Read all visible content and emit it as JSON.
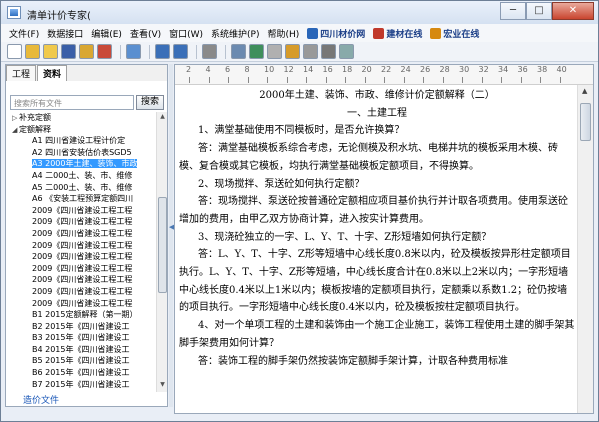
{
  "window": {
    "title": "清单计价专家("
  },
  "menu": [
    "文件(F)",
    "数据接口",
    "编辑(E)",
    "查看(V)",
    "窗口(W)",
    "系统维护(P)",
    "帮助(H)"
  ],
  "menu_extra": [
    {
      "label": "四川材价网",
      "icon": "grid-icon",
      "color": "#2a66b8"
    },
    {
      "label": "建材在线",
      "icon": "swirl-icon",
      "color": "#c0392b"
    },
    {
      "label": "宏业在线",
      "icon": "person-icon",
      "color": "#d68910"
    }
  ],
  "toolbar": {
    "items": [
      "new-doc",
      "open-folder",
      "open-file",
      "save",
      "save-all",
      "export",
      "sep",
      "calc-settings",
      "sep",
      "undo",
      "redo",
      "sep",
      "stop",
      "sep",
      "print",
      "refresh",
      "lock",
      "user",
      "font",
      "align",
      "options"
    ]
  },
  "left_panel": {
    "tabs": [
      "工程",
      "资料"
    ],
    "active_tab": "资料",
    "search_placeholder": "搜索所有文件",
    "search_button": "搜索",
    "tree": [
      {
        "text": "补充定额",
        "level": 0,
        "exp": "+"
      },
      {
        "text": "定额解释",
        "level": 0,
        "exp": "-"
      },
      {
        "text": "A1 四川省建设工程计价定",
        "level": 1
      },
      {
        "text": "A2 四川省安装估价表SGD5",
        "level": 1
      },
      {
        "text": "A3 2000年土建、装饰、市政",
        "level": 1,
        "selected": true
      },
      {
        "text": "A4 二000土、装、市、维修",
        "level": 1
      },
      {
        "text": "A5 二000土、装、市、维修",
        "level": 1
      },
      {
        "text": "A6 《安装工程预算定额四川",
        "level": 1
      },
      {
        "text": "2009《四川省建设工程工程",
        "level": 1
      },
      {
        "text": "2009《四川省建设工程工程",
        "level": 1
      },
      {
        "text": "2009《四川省建设工程工程",
        "level": 1
      },
      {
        "text": "2009《四川省建设工程工程",
        "level": 1
      },
      {
        "text": "2009《四川省建设工程工程",
        "level": 1
      },
      {
        "text": "2009《四川省建设工程工程",
        "level": 1
      },
      {
        "text": "2009《四川省建设工程工程",
        "level": 1
      },
      {
        "text": "2009《四川省建设工程工程",
        "level": 1
      },
      {
        "text": "2009《四川省建设工程工程",
        "level": 1
      },
      {
        "text": "B1 2015定额解释（第一期）",
        "level": 1
      },
      {
        "text": "B2 2015年《四川省建设工",
        "level": 1
      },
      {
        "text": "B3 2015年《四川省建设工",
        "level": 1
      },
      {
        "text": "B4 2015年《四川省建设工",
        "level": 1
      },
      {
        "text": "B5 2015年《四川省建设工",
        "level": 1
      },
      {
        "text": "B6 2015年《四川省建设工",
        "level": 1
      },
      {
        "text": "B7 2015年《四川省建设工",
        "level": 1
      }
    ],
    "bottom_tab": "造价文件"
  },
  "ruler": {
    "marks": [
      "2",
      "4",
      "6",
      "8",
      "10",
      "12",
      "14",
      "16",
      "18",
      "20",
      "22",
      "24",
      "26",
      "28",
      "30",
      "32",
      "34",
      "36",
      "38",
      "40"
    ]
  },
  "document": {
    "paragraphs": [
      {
        "text": "2000年土建、装饰、市政、维修计价定额解释（二）",
        "center": true
      },
      {
        "text": "一、土建工程",
        "center": true
      },
      {
        "text": "1、满堂基础使用不同模板时，是否允许换算？"
      },
      {
        "text": "答：满堂基础模板系综合考虑，无论侧模及积水坑、电梯井坑的模板采用木模、砖模、复合模或其它模板，均执行满堂基础模板定额项目，不得换算。"
      },
      {
        "text": "2、现场搅拌、泵送砼如何执行定额？"
      },
      {
        "text": "答：现场搅拌、泵送砼按普通砼定额相应项目基价执行并计取各项费用。使用泵送砼增加的费用，由甲乙双方协商计算，进入按实计算费用。"
      },
      {
        "text": "3、现浇砼独立的一字、L、Y、T、十字、Z形短墙如何执行定额？"
      },
      {
        "text": "答：L、Y、T、十字、Z形等短墙中心线长度0.8米以内，砼及模板按异形柱定额项目执行。L、Y、T、十字、Z形等短墙，中心线长度合计在0.8米以上2米以内；一字形短墙中心线长度0.4米以上1米以内；模板按墙的定额项目执行，定额乘以系数1.2；砼仍按墙的项目执行。一字形短墙中心线长度0.4米以内，砼及模板按柱定额项目执行。"
      },
      {
        "text": "4、对一个单项工程的土建和装饰由一个施工企业施工，装饰工程使用土建的脚手架其脚手架费用如何计算？"
      },
      {
        "text": "答：装饰工程的脚手架仍然按装饰定额脚手架计算，计取各种费用标准"
      }
    ]
  }
}
